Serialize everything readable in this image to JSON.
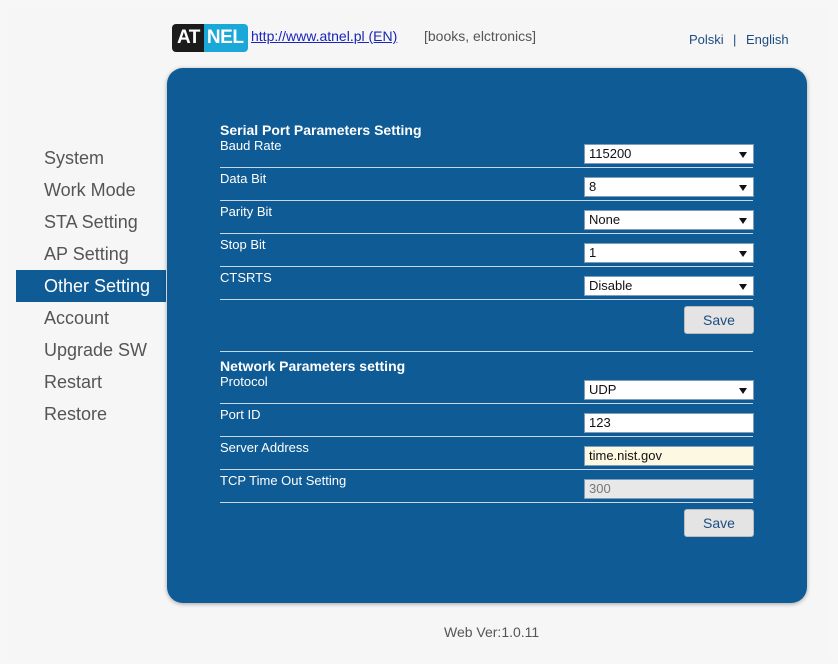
{
  "header": {
    "logo_left": "AT",
    "logo_right": "NEL",
    "site_link": "http://www.atnel.pl (EN)",
    "site_tagline": "[books, elctronics]",
    "lang_polish": "Polski",
    "lang_sep": "|",
    "lang_english": "English"
  },
  "sidebar": {
    "items": [
      {
        "label": "System"
      },
      {
        "label": "Work Mode"
      },
      {
        "label": "STA Setting"
      },
      {
        "label": "AP Setting"
      },
      {
        "label": "Other Setting",
        "active": true
      },
      {
        "label": "Account"
      },
      {
        "label": "Upgrade SW"
      },
      {
        "label": "Restart"
      },
      {
        "label": "Restore"
      }
    ]
  },
  "serial": {
    "title": "Serial Port Parameters Setting",
    "rows": [
      {
        "label": "Baud Rate",
        "value": "115200"
      },
      {
        "label": "Data Bit",
        "value": "8"
      },
      {
        "label": "Parity Bit",
        "value": "None"
      },
      {
        "label": "Stop Bit",
        "value": "1"
      },
      {
        "label": "CTSRTS",
        "value": "Disable"
      }
    ],
    "save_label": "Save"
  },
  "network": {
    "title": "Network Parameters setting",
    "rows": [
      {
        "label": "Protocol",
        "value": "UDP"
      },
      {
        "label": "Port ID",
        "value": "123"
      },
      {
        "label": "Server Address",
        "value": "time.nist.gov"
      },
      {
        "label": "TCP Time Out Setting",
        "value": "300"
      }
    ],
    "save_label": "Save"
  },
  "footer": {
    "version": "Web Ver:1.0.11"
  },
  "colors": {
    "panel": "#0f5b95",
    "active_nav": "#0f5b95",
    "link": "#1a26b8"
  }
}
